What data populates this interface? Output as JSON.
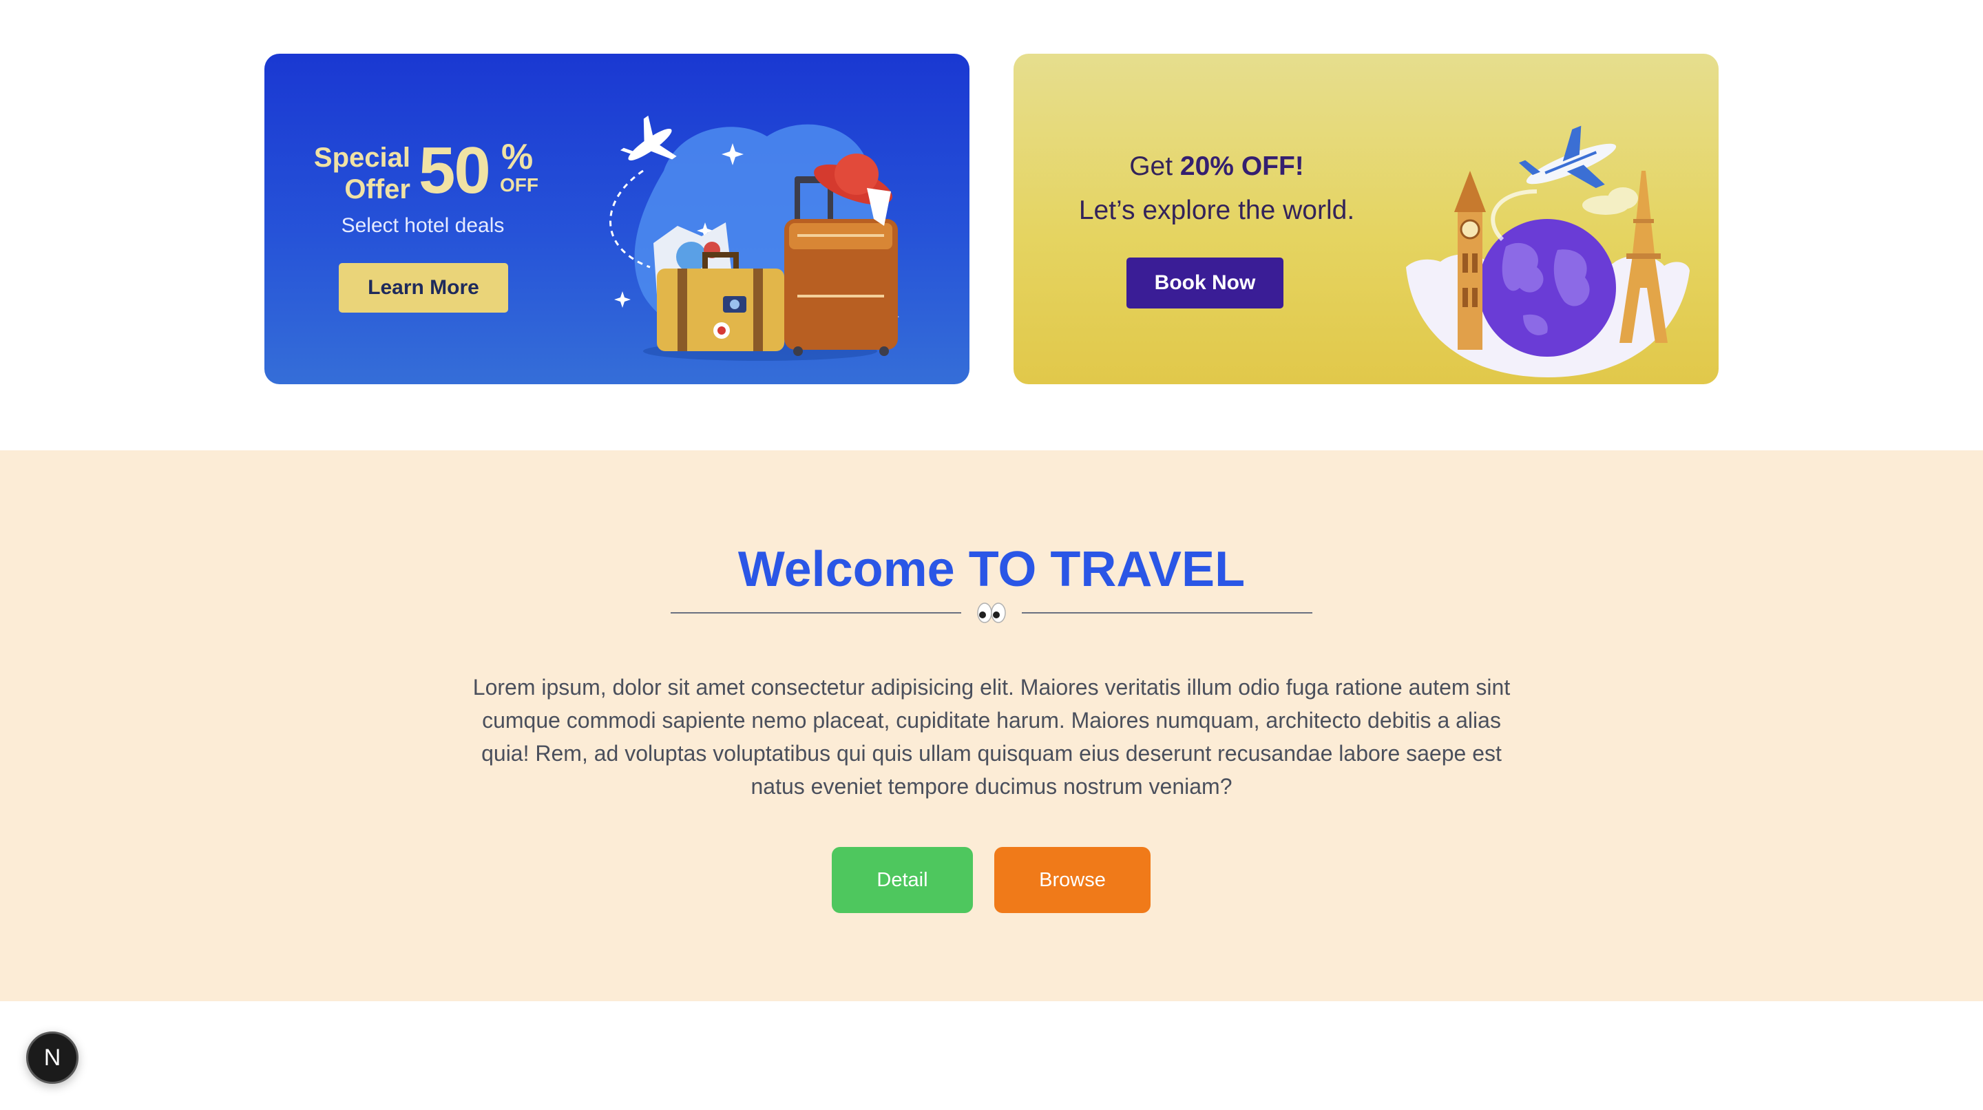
{
  "banners": {
    "hotel": {
      "special": "Special",
      "offer": "Offer",
      "discount_number": "50",
      "percent_sign": "%",
      "off_label": "OFF",
      "subtitle": "Select hotel deals",
      "button_label": "Learn More"
    },
    "explore": {
      "get": "Get",
      "discount": "20% OFF!",
      "tagline": "Let’s explore the world.",
      "button_label": "Book Now"
    }
  },
  "welcome": {
    "title": "Welcome TO TRAVEL",
    "divider_icon": "eyes-emoji",
    "body": "Lorem ipsum, dolor sit amet consectetur adipisicing elit. Maiores veritatis illum odio fuga ratione autem sint cumque commodi sapiente nemo placeat, cupiditate harum. Maiores numquam, architecto debitis a alias quia! Rem, ad voluptas voluptatibus qui quis ullam quisquam eius deserunt recusandae labore saepe est natus eveniet tempore ducimus nostrum veniam?",
    "detail_label": "Detail",
    "browse_label": "Browse"
  },
  "dev_badge": {
    "letter": "N"
  },
  "colors": {
    "blue_banner": "#1a38d2",
    "yellow_banner": "#e5d461",
    "title_blue": "#2a56e6",
    "section_bg": "#fcecd6",
    "detail_green": "#4ec75e",
    "browse_orange": "#f07a19",
    "book_purple": "#3a1d96",
    "learn_yellow": "#ead479"
  }
}
